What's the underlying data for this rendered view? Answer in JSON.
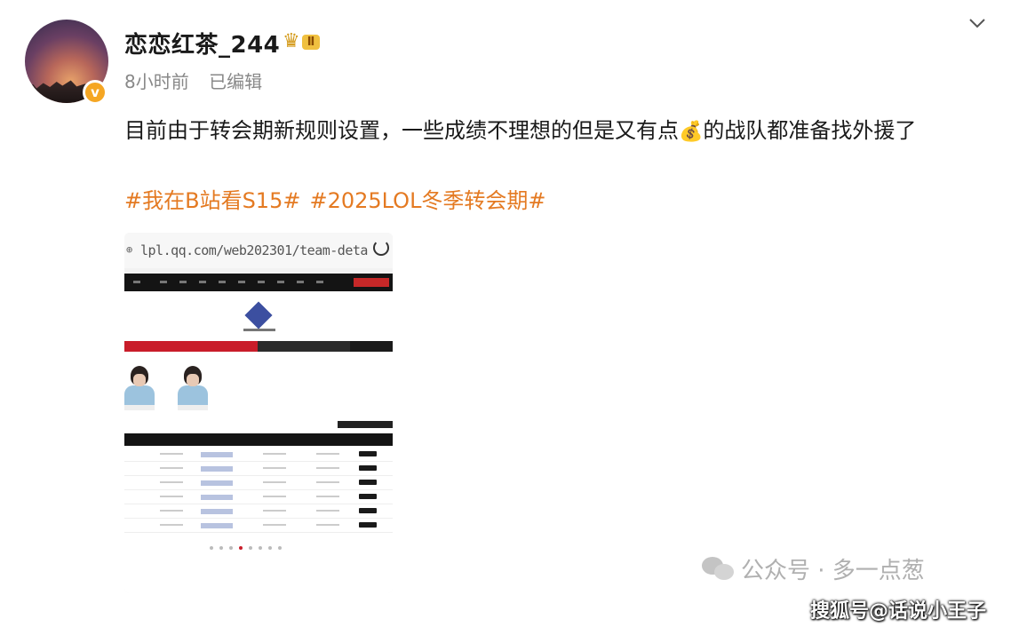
{
  "post": {
    "username": "恋恋红茶_244",
    "level_badge": "Ⅱ",
    "verified_mark": "v",
    "time": "8小时前",
    "edited": "已编辑",
    "text_before_icon": "目前由于转会期新规则设置，一些成绩不理想的但是又有点",
    "icon_inline": "money-bag-emoji",
    "text_after_icon": "的战队都准备找外援了",
    "hashtags": [
      "#我在B站看S15#",
      "#2025LOL冬季转会期#"
    ]
  },
  "embedded_image": {
    "url": "lpl.qq.com/web202301/team-deta"
  },
  "watermarks": {
    "wechat": "公众号 · 多一点葱",
    "sohu": "搜狐号@话说小王子"
  }
}
